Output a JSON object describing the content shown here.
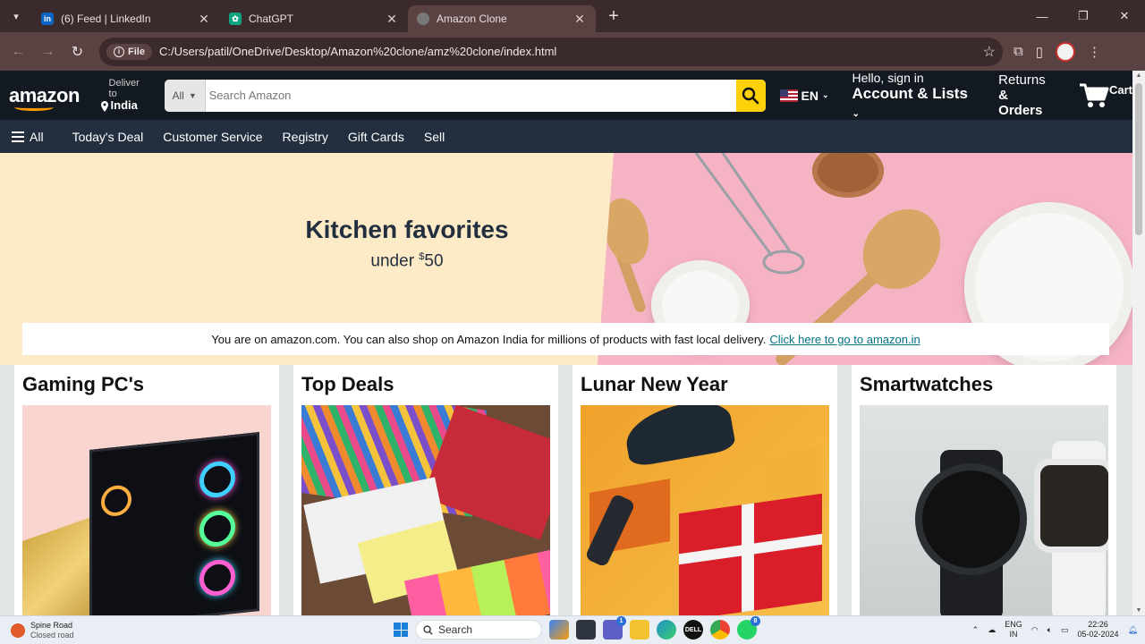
{
  "browser": {
    "tabs": [
      {
        "title": "(6) Feed | LinkedIn",
        "favicon": "linkedin-icon",
        "color": "#0a66c2",
        "active": false
      },
      {
        "title": "ChatGPT",
        "favicon": "chatgpt-icon",
        "color": "#10a37f",
        "active": false
      },
      {
        "title": "Amazon Clone",
        "favicon": "globe-icon",
        "color": "#777777",
        "active": true
      }
    ],
    "chip_label": "File",
    "url": "C:/Users/patil/OneDrive/Desktop/Amazon%20clone/amz%20clone/index.html"
  },
  "header": {
    "logo_text": "amazon",
    "deliver_small": "Deliver to",
    "deliver_big": "India",
    "search_category": "All",
    "search_placeholder": "Search Amazon",
    "language": "EN",
    "account_small": "Hello, sign in",
    "account_big": "Account & Lists",
    "returns_small": "Returns",
    "returns_big": "& Orders",
    "cart_label": "Cart"
  },
  "subnav": {
    "all_label": "All",
    "items": [
      "Today's Deal",
      "Customer Service",
      "Registry",
      "Gift Cards",
      "Sell"
    ]
  },
  "hero": {
    "title": "Kitchen favorites",
    "subtitle_prefix": "under ",
    "subtitle_currency": "$",
    "subtitle_amount": "50"
  },
  "notice": {
    "text": "You are on amazon.com. You can also shop on Amazon India for millions of products with fast local delivery.",
    "link": "Click here to go to amazon.in"
  },
  "cards": [
    {
      "title": "Gaming PC's"
    },
    {
      "title": "Top Deals"
    },
    {
      "title": "Lunar New Year"
    },
    {
      "title": "Smartwatches"
    }
  ],
  "taskbar": {
    "weather_title": "Spine Road",
    "weather_sub": "Closed road",
    "search_label": "Search",
    "lang_top": "ENG",
    "lang_bottom": "IN",
    "time": "22:26",
    "date": "05-02-2024"
  },
  "colors": {
    "amazon_dark": "#131921",
    "amazon_nav": "#232f3e",
    "search_button": "#fdd20a",
    "accent_orange": "#ff9900",
    "link": "#007185"
  }
}
